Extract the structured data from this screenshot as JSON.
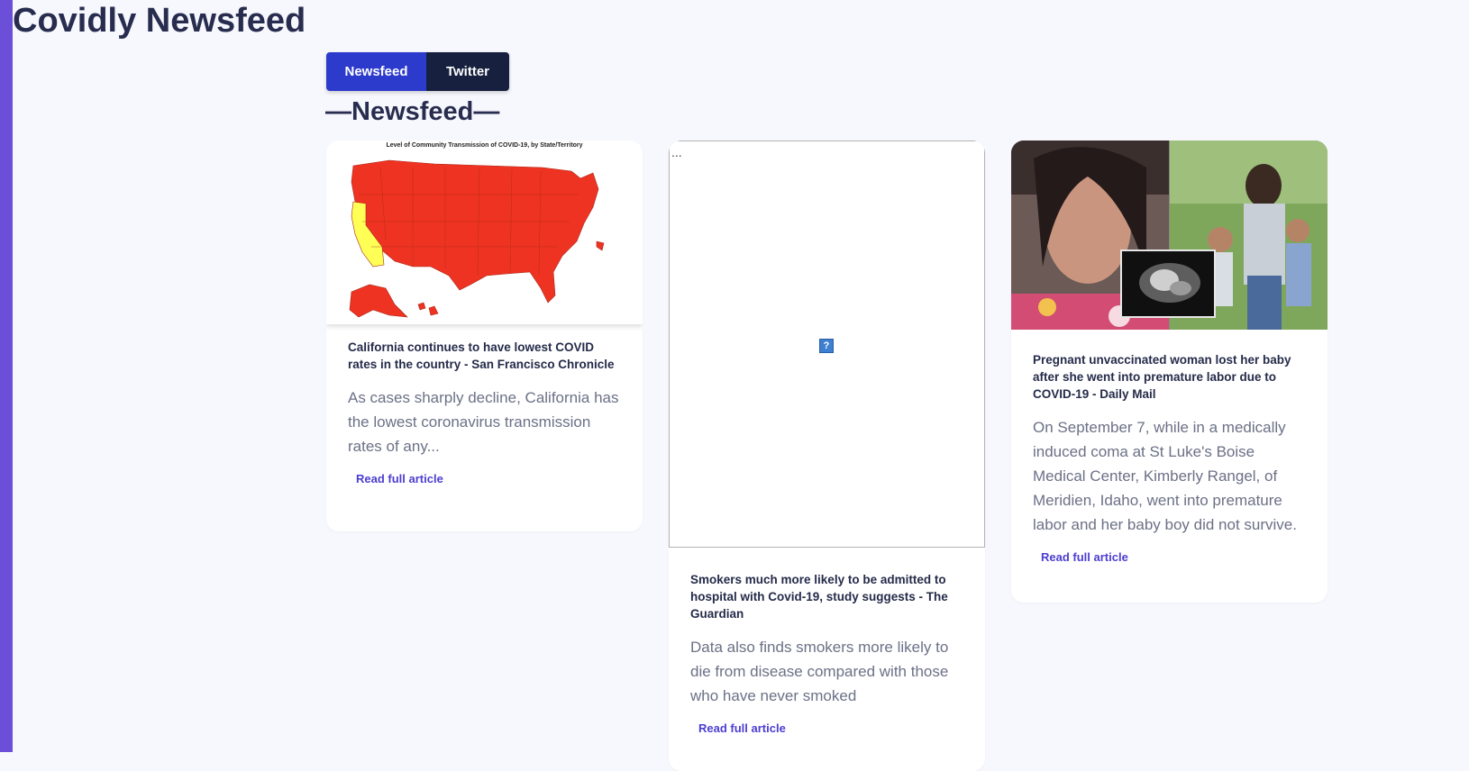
{
  "app": {
    "title": "Covidly Newsfeed"
  },
  "tabs": [
    {
      "label": "Newsfeed"
    },
    {
      "label": "Twitter"
    }
  ],
  "section": {
    "heading": "—Newsfeed—"
  },
  "colors": {
    "accent_purple": "#6c4fd8",
    "tab_active": "#2d3bcc",
    "tab_dark": "#17213f",
    "link": "#4c3ed1",
    "map_red": "#ee3322",
    "map_yellow": "#ffff55"
  },
  "articles": [
    {
      "image_caption": "Level of Community Transmission of COVID-19, by State/Territory",
      "title": "California continues to have lowest COVID rates in the country - San Francisco Chronicle",
      "description": "As cases sharply decline, California has the lowest coronavirus transmission rates of any...",
      "link_label": "Read full article"
    },
    {
      "image_status": "broken",
      "broken_dots": "...",
      "broken_icon": "?",
      "title": "Smokers much more likely to be admitted to hospital with Covid-19, study suggests - The Guardian",
      "description": "Data also finds smokers more likely to die from disease compared with those who have never smoked",
      "link_label": "Read full article"
    },
    {
      "title": "Pregnant unvaccinated woman lost her baby after she went into premature labor due to COVID-19 - Daily Mail",
      "description": "On September 7, while in a medically induced coma at St Luke's Boise Medical Center, Kimberly Rangel, of Meridien, Idaho, went into premature labor and her baby boy did not survive.",
      "link_label": "Read full article"
    }
  ]
}
